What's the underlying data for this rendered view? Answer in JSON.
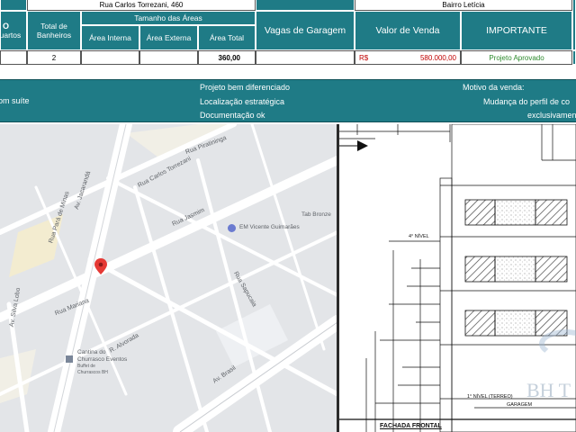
{
  "sheet": {
    "address": "Rua Carlos Torrezani, 460",
    "neighborhood": "Bairro Letícia",
    "partial_icon_glyph": "O",
    "headers": {
      "quartos": "Quartos",
      "banheiros": "Total de Banheiros",
      "tamanho_areas": "Tamanho das Áreas",
      "area_interna": "Área Interna",
      "area_externa": "Área Externa",
      "area_total": "Área Total",
      "vagas": "Vagas de Garagem",
      "valor": "Valor de Venda",
      "importante": "IMPORTANTE"
    },
    "row": {
      "quartos": "",
      "banheiros": "2",
      "area_interna": "",
      "area_externa": "",
      "area_total": "360,00",
      "vagas": "",
      "currency": "R$",
      "valor": "580.000,00",
      "importante": "Projeto Aprovado"
    },
    "info": {
      "left": "om suíte",
      "middle_1": "Projeto bem diferenciado",
      "middle_2": "Localização estratégica",
      "middle_3": "Documentação ok",
      "right_1": "Motivo da venda:",
      "right_2": "Mudança do perfil de co",
      "right_3": "exclusivamen"
    },
    "colors": {
      "teal": "#1f7b86",
      "value_red": "#c00000",
      "approved_green": "#2e8b2e"
    }
  },
  "map": {
    "roads": [
      "Rua Carlos Torrezani",
      "Rua Pará de Minas",
      "Av. Jacarandá",
      "Rua Jasmim",
      "Av. Silva Lobo",
      "Rua Mariana",
      "Rua Sapucaia",
      "Rua Piratininga",
      "Av. Brasil",
      "R. Alvorada"
    ],
    "pois": {
      "school": "EM Vicente Guimarães",
      "shop": "Tab Bronze",
      "restaurant_1": "Cantina do",
      "restaurant_2": "Churrasco Eventos",
      "restaurant_3": "Buffet de",
      "restaurant_4": "Churrascos BH"
    },
    "marker_icon": "map-pin-icon"
  },
  "plan": {
    "level_4": "4° NÍVEL",
    "level_1": "1° NÍVEL (TERREO)",
    "garagem": "GARAGEM",
    "fachada": "FACHADA FRONTAL",
    "watermark": "BH T"
  }
}
